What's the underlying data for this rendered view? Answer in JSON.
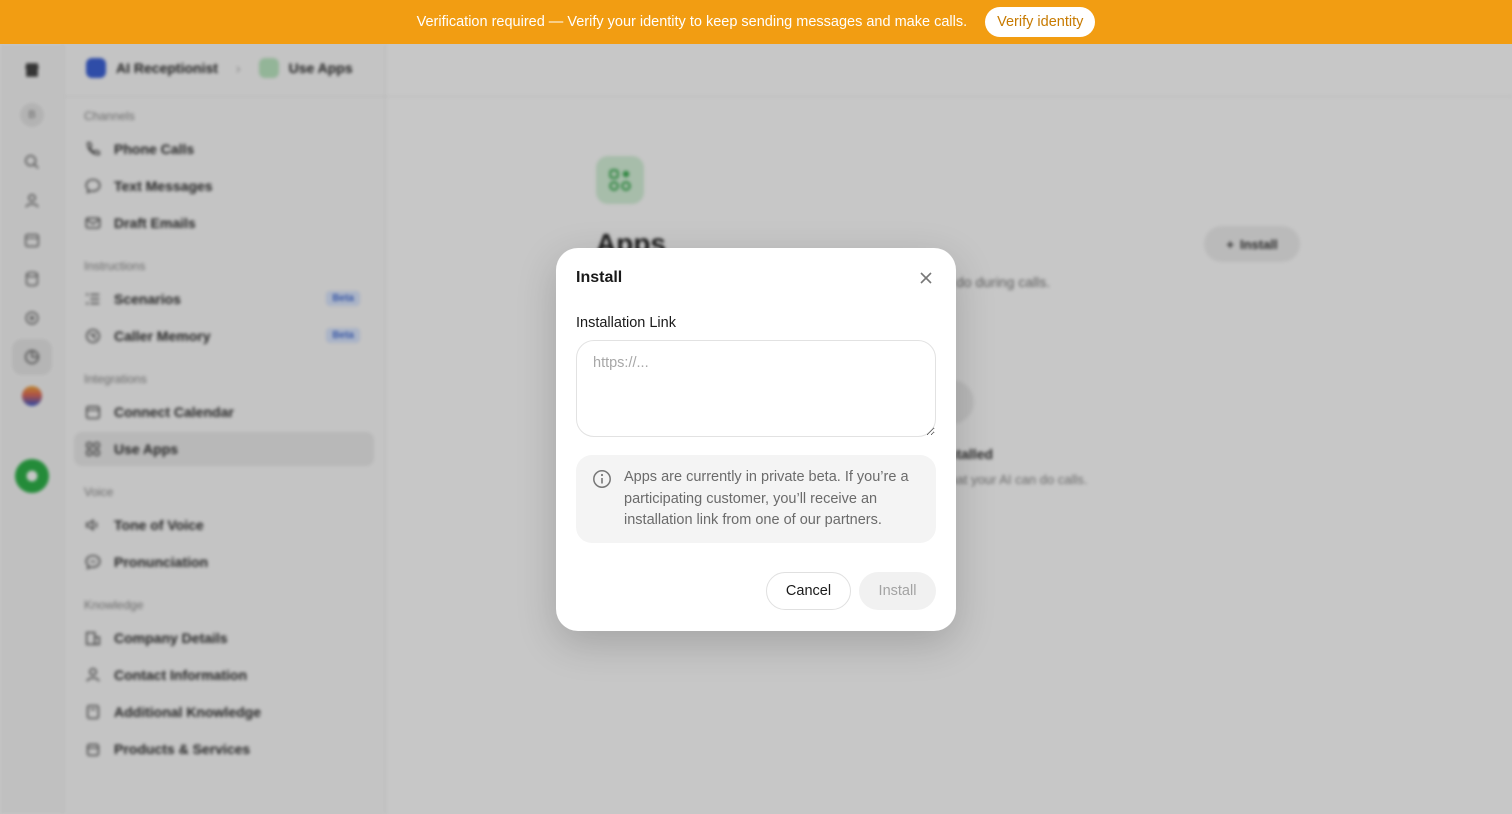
{
  "banner": {
    "text": "Verification required — Verify your identity to keep sending messages and make calls.",
    "button_label": "Verify identity"
  },
  "rail": {
    "avatar_initial": "B",
    "icons": [
      "store-icon",
      "search-icon",
      "user-icon",
      "calendar-icon",
      "database-icon",
      "settings-icon",
      "analytics-icon"
    ]
  },
  "breadcrumb": {
    "items": [
      "AI Receptionist",
      "Use Apps"
    ]
  },
  "sidebar": {
    "sections": [
      {
        "label": "Channels",
        "items": [
          {
            "label": "Phone Calls",
            "icon": "phone-icon"
          },
          {
            "label": "Text Messages",
            "icon": "chat-bubble-icon"
          },
          {
            "label": "Draft Emails",
            "icon": "mail-icon"
          }
        ]
      },
      {
        "label": "Instructions",
        "items": [
          {
            "label": "Scenarios",
            "icon": "list-icon",
            "badge": "Beta"
          },
          {
            "label": "Caller Memory",
            "icon": "memory-icon",
            "badge": "Beta"
          }
        ]
      },
      {
        "label": "Integrations",
        "items": [
          {
            "label": "Connect Calendar",
            "icon": "calendar-icon"
          },
          {
            "label": "Use Apps",
            "icon": "apps-icon",
            "active": true
          }
        ]
      },
      {
        "label": "Voice",
        "items": [
          {
            "label": "Tone of Voice",
            "icon": "speaker-icon"
          },
          {
            "label": "Pronunciation",
            "icon": "pronunciation-icon"
          }
        ]
      },
      {
        "label": "Knowledge",
        "items": [
          {
            "label": "Company Details",
            "icon": "building-icon"
          },
          {
            "label": "Contact Information",
            "icon": "contact-icon"
          },
          {
            "label": "Additional Knowledge",
            "icon": "book-icon"
          },
          {
            "label": "Products & Services",
            "icon": "box-icon"
          }
        ]
      }
    ]
  },
  "main": {
    "title": "Apps",
    "subtitle_fragment": "do during calls.",
    "install_button": "Install",
    "empty_title_fragment": "nstalled",
    "empty_desc_fragment": "what your AI can do calls."
  },
  "modal": {
    "title": "Install",
    "field_label": "Installation Link",
    "input_value": "",
    "input_placeholder": "https://...",
    "info_text": "Apps are currently in private beta. If you’re a participating customer, you’ll receive an installation link from one of our partners.",
    "cancel_label": "Cancel",
    "install_label": "Install"
  },
  "colors": {
    "banner": "#f29d12",
    "accent_green": "#2fb34a",
    "beta_badge": "#dbe7ff"
  }
}
